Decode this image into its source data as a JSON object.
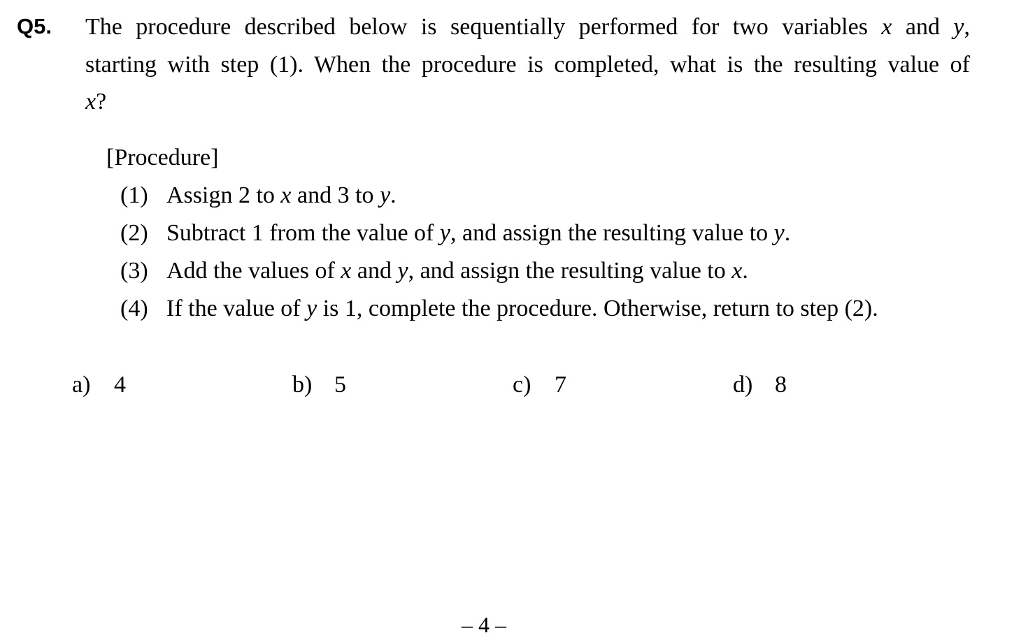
{
  "question": {
    "number": "Q5.",
    "line1_a": "The procedure described below is sequentially performed for two variables ",
    "var_x": "x",
    "and": " and ",
    "var_y": "y",
    "line1_end": ",",
    "line2": "starting with step (1).    When the procedure is completed, what is the resulting value of",
    "line3_var": "x",
    "line3_end": "?"
  },
  "procedure": {
    "title": "[Procedure]",
    "steps": [
      {
        "num": "(1)",
        "parts": [
          "Assign 2 to ",
          "x",
          " and 3 to ",
          "y",
          "."
        ]
      },
      {
        "num": "(2)",
        "parts": [
          "Subtract 1 from the value of ",
          "y",
          ", and assign the resulting value to ",
          "y",
          "."
        ]
      },
      {
        "num": "(3)",
        "parts": [
          "Add the values of ",
          "x",
          " and ",
          "y",
          ", and assign the resulting value to ",
          "x",
          "."
        ]
      },
      {
        "num": "(4)",
        "parts": [
          "If the value of ",
          "y",
          " is 1, complete the procedure. Otherwise, return to step (2)."
        ]
      }
    ]
  },
  "choices": [
    {
      "label": "a)",
      "value": "4"
    },
    {
      "label": "b)",
      "value": "5"
    },
    {
      "label": "c)",
      "value": "7"
    },
    {
      "label": "d)",
      "value": "8"
    }
  ],
  "page_number": "– 4 –"
}
